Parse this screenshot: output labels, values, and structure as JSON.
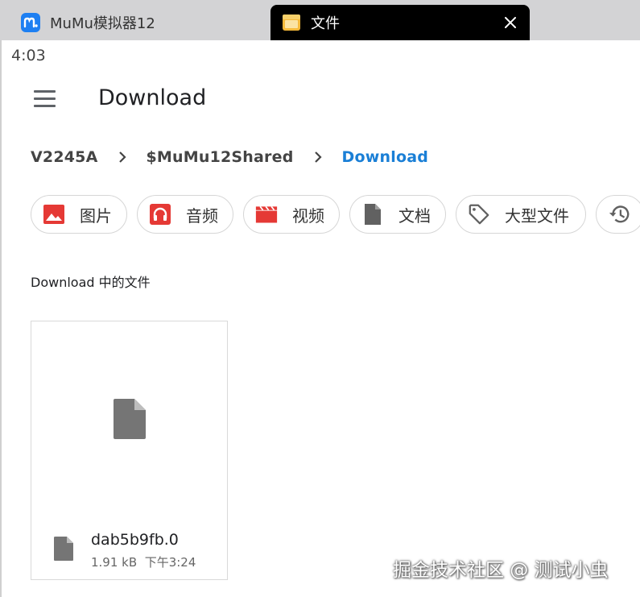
{
  "window": {
    "tabs": [
      {
        "label": "MuMu模拟器12",
        "icon": "mumu-logo-icon",
        "active": false
      },
      {
        "label": "文件",
        "icon": "folder-icon",
        "active": true
      }
    ],
    "close_icon": "close-icon"
  },
  "status": {
    "time": "4:03"
  },
  "appbar": {
    "title": "Download",
    "menu_icon": "hamburger-menu-icon"
  },
  "breadcrumb": {
    "items": [
      "V2245A",
      "$MuMu12Shared",
      "Download"
    ],
    "separator_icon": "chevron-right-icon"
  },
  "chips": [
    {
      "label": "图片",
      "icon": "image-icon",
      "color": "#e53935"
    },
    {
      "label": "音频",
      "icon": "headphones-icon",
      "color": "#e53935"
    },
    {
      "label": "视频",
      "icon": "movie-clapper-icon",
      "color": "#e53935"
    },
    {
      "label": "文档",
      "icon": "document-icon",
      "color": "#616161"
    },
    {
      "label": "大型文件",
      "icon": "tag-icon",
      "color": "#616161"
    },
    {
      "label": "",
      "icon": "history-icon",
      "color": "#616161"
    }
  ],
  "section": {
    "label": "Download 中的文件"
  },
  "files": [
    {
      "name": "dab5b9fb.0",
      "size": "1.91 kB",
      "time": "下午3:24",
      "icon": "file-icon"
    }
  ],
  "watermark": "掘金技术社区 @ 测试小虫"
}
